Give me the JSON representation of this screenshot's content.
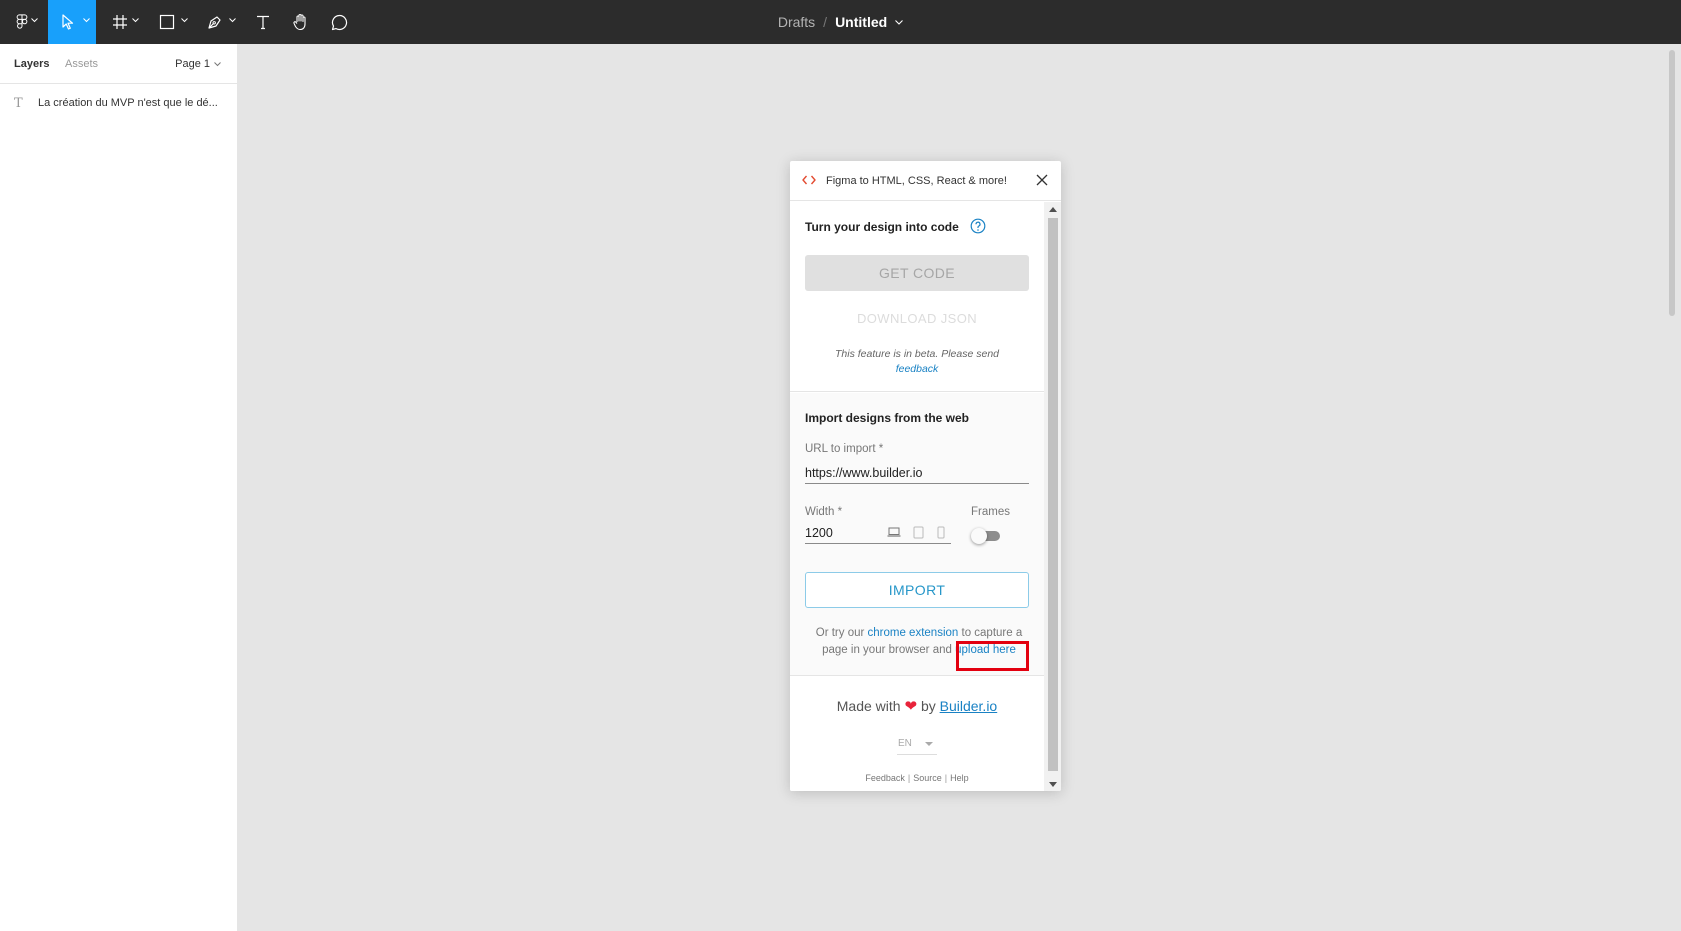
{
  "toolbar": {
    "tools": [
      {
        "name": "figma-menu"
      },
      {
        "name": "move-tool"
      },
      {
        "name": "frame-tool"
      },
      {
        "name": "shape-tool"
      },
      {
        "name": "pen-tool"
      },
      {
        "name": "text-tool"
      },
      {
        "name": "hand-tool"
      },
      {
        "name": "comment-tool"
      }
    ],
    "active_tool": "move-tool",
    "active_color": "#18a0fb",
    "breadcrumb": "Drafts",
    "separator": "/",
    "file_title": "Untitled"
  },
  "left_panel": {
    "tabs": [
      {
        "label": "Layers",
        "active": true
      },
      {
        "label": "Assets",
        "active": false
      }
    ],
    "page_selector": "Page 1",
    "layers": [
      {
        "type": "text",
        "icon": "T",
        "label": "La création du MVP n'est que le dé..."
      }
    ]
  },
  "plugin": {
    "title": "Figma to HTML, CSS, React & more!",
    "code_section": {
      "heading": "Turn your design into code",
      "get_code_label": "GET CODE",
      "download_json_label": "DOWNLOAD JSON",
      "beta_text": "This feature is in beta. Please send",
      "beta_link": "feedback"
    },
    "import_section": {
      "heading": "Import designs from the web",
      "url_label": "URL to import",
      "url_value": "https://www.builder.io",
      "required_mark": "*",
      "width_label": "Width",
      "width_value": "1200",
      "frames_label": "Frames",
      "frames_enabled": false,
      "import_label": "IMPORT",
      "or_try_prefix": "Or try our",
      "chrome_extension_link": "chrome extension",
      "or_try_middle": "to capture a page in your browser and",
      "upload_link": "upload here"
    },
    "footer": {
      "made_with": "Made with",
      "heart": "❤",
      "by": "by",
      "builder_link": "Builder.io",
      "language": "EN",
      "links": [
        "Feedback",
        "Source",
        "Help"
      ],
      "link_separator": "|"
    },
    "colors": {
      "link": "#1a82c4",
      "highlight": "#e3000f",
      "heart": "#e8233a"
    }
  }
}
